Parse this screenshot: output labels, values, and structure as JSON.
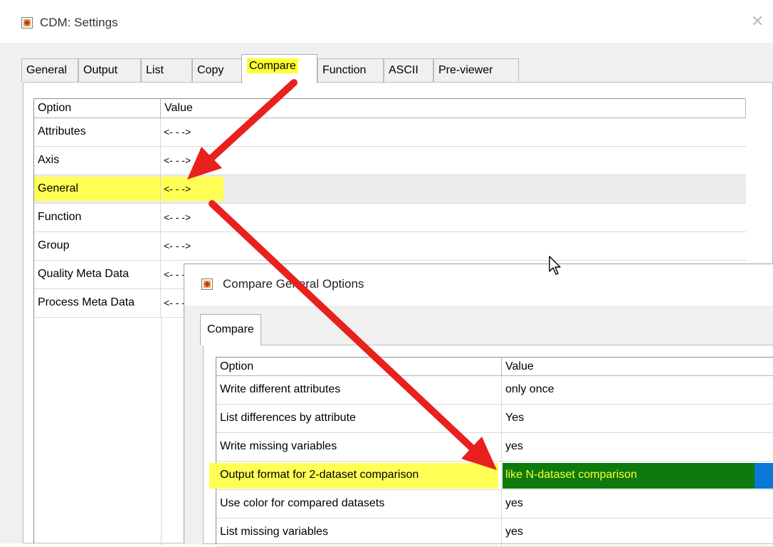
{
  "window": {
    "title": "CDM: Settings",
    "app_icon": "cdm-app-icon",
    "close_icon": "close-icon"
  },
  "tabs": [
    {
      "label": "General"
    },
    {
      "label": "Output"
    },
    {
      "label": "List"
    },
    {
      "label": "Copy"
    },
    {
      "label": "Compare",
      "active": true
    },
    {
      "label": "Function"
    },
    {
      "label": "ASCII"
    },
    {
      "label": "Pre-viewer"
    }
  ],
  "grid": {
    "headers": {
      "option": "Option",
      "value": "Value"
    },
    "rows": [
      {
        "option": "Attributes",
        "value": "<- - ->"
      },
      {
        "option": "Axis",
        "value": "<- - ->"
      },
      {
        "option": "General",
        "value": "<- - ->"
      },
      {
        "option": "Function",
        "value": "<- - ->"
      },
      {
        "option": "Group",
        "value": "<- - ->"
      },
      {
        "option": "Quality Meta Data",
        "value": "<- - ->"
      },
      {
        "option": "Process Meta Data",
        "value": "<- - ->"
      }
    ]
  },
  "dialog": {
    "title": "Compare General Options",
    "tab": "Compare",
    "headers": {
      "option": "Option",
      "value": "Value"
    },
    "rows": [
      {
        "option": "Write different attributes",
        "value": "only once"
      },
      {
        "option": "List differences by attribute",
        "value": "Yes"
      },
      {
        "option": "Write missing variables",
        "value": "yes"
      },
      {
        "option": "Output format for 2-dataset comparison",
        "value": "like N-dataset comparison"
      },
      {
        "option": "Use color for compared datasets",
        "value": "yes"
      },
      {
        "option": "List missing variables",
        "value": "yes"
      }
    ]
  },
  "colors": {
    "highlight": "#ffff55",
    "arrow": "#e8201e",
    "selection": "#0c7a0c",
    "selection_text": "#ffff33"
  },
  "cursor": "mouse-pointer-icon"
}
